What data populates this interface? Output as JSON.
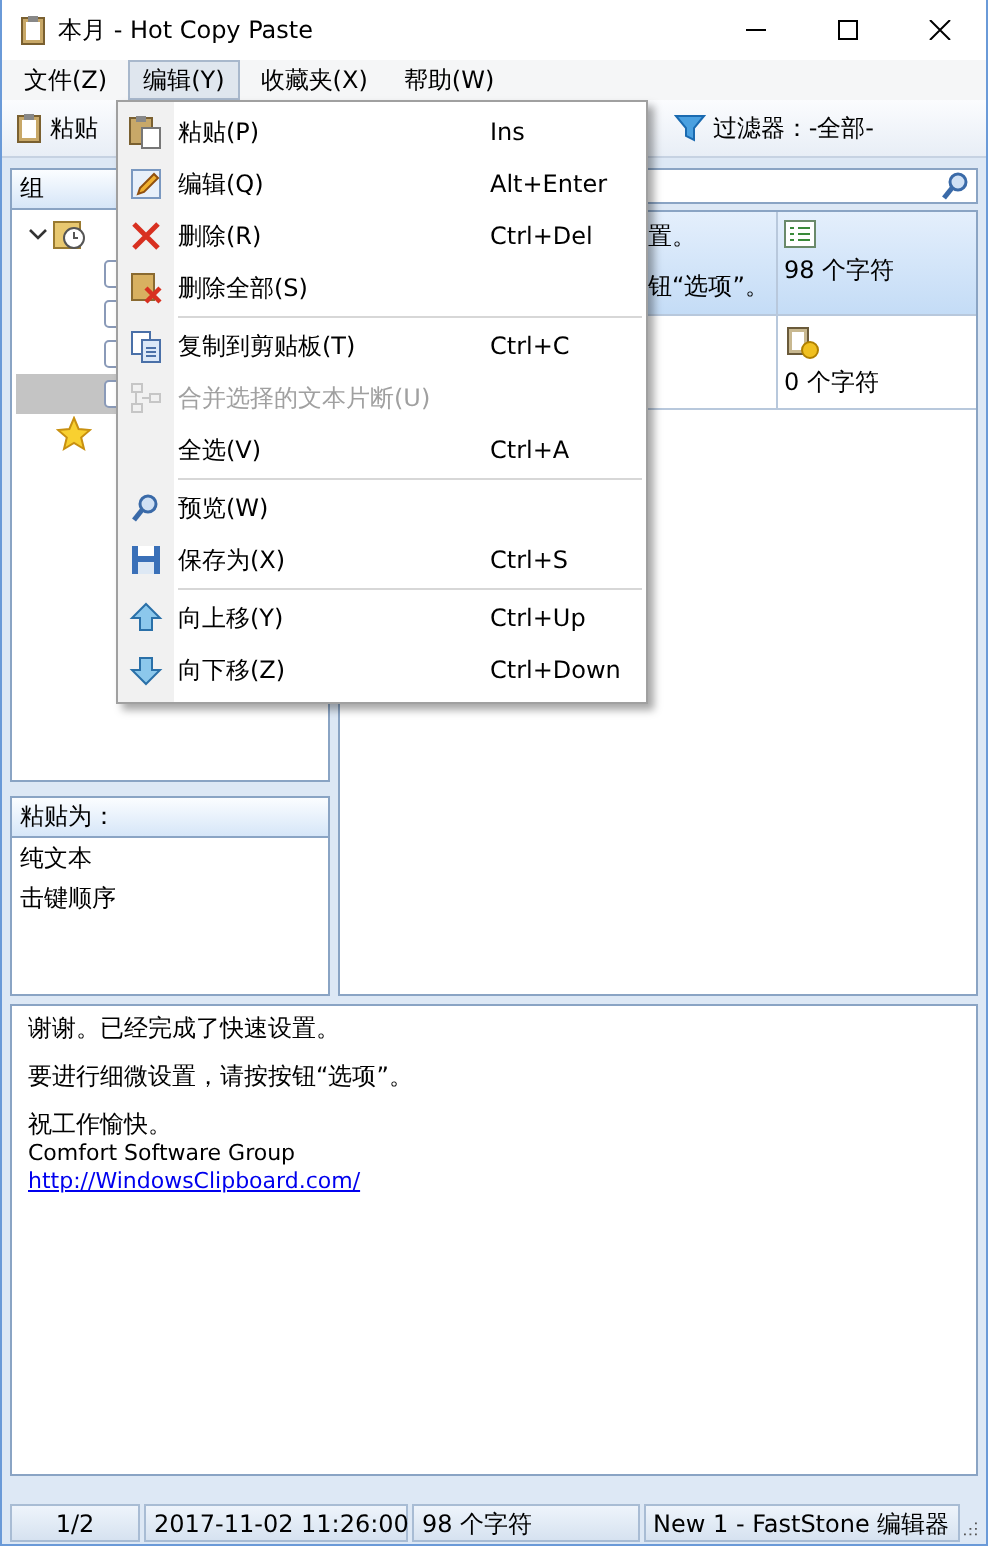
{
  "window": {
    "title": "本月 - Hot Copy Paste"
  },
  "menubar": [
    {
      "label": "文件(Z)",
      "selected": false
    },
    {
      "label": "编辑(Y)",
      "selected": true
    },
    {
      "label": "收藏夹(X)",
      "selected": false
    },
    {
      "label": "帮助(W)",
      "selected": false
    }
  ],
  "toolbar": {
    "paste_button": "粘贴",
    "filter": "过滤器：-全部-"
  },
  "groups_panel": {
    "header": "组",
    "tree": [
      {
        "kind": "history",
        "expanded": true,
        "children": [
          {
            "selected": false
          },
          {
            "selected": false
          },
          {
            "selected": false
          },
          {
            "selected": true
          }
        ]
      },
      {
        "kind": "favorites"
      }
    ]
  },
  "clips": {
    "rows": [
      {
        "selected": true,
        "kind": "text",
        "text": [
          "置。",
          "钮“选项”。"
        ],
        "size": "98 个字符"
      },
      {
        "selected": false,
        "kind": "clipboard",
        "size": "0 个字符"
      }
    ]
  },
  "paste_as": {
    "header": "粘贴为：",
    "items": [
      "纯文本",
      "击键顺序"
    ]
  },
  "preview": {
    "paragraphs": [
      "谢谢。已经完成了快速设置。",
      "要进行细微设置，请按按钮“选项”。",
      "祝工作愉快。"
    ],
    "signature": "Comfort Software Group",
    "link": "http://WindowsClipboard.com/"
  },
  "status_bar": [
    "1/2",
    "2017-11-02 11:26:00",
    "98 个字符",
    "New 1 - FastStone 编辑器"
  ],
  "menu": {
    "items": [
      {
        "kind": "item",
        "label": "粘贴(P)",
        "shortcut": "Ins",
        "disabled": false
      },
      {
        "kind": "item",
        "label": "编辑(Q)",
        "shortcut": "Alt+Enter",
        "disabled": false
      },
      {
        "kind": "item",
        "label": "删除(R)",
        "shortcut": "Ctrl+Del",
        "disabled": false
      },
      {
        "kind": "item",
        "label": "删除全部(S)",
        "disabled": false
      },
      {
        "kind": "separator"
      },
      {
        "kind": "item",
        "label": "复制到剪贴板(T)",
        "shortcut": "Ctrl+C",
        "disabled": false
      },
      {
        "kind": "item",
        "label": "合并选择的文本片断(U)",
        "disabled": true
      },
      {
        "kind": "item",
        "label": "全选(V)",
        "shortcut": "Ctrl+A",
        "disabled": false
      },
      {
        "kind": "separator"
      },
      {
        "kind": "item",
        "label": "预览(W)",
        "disabled": false
      },
      {
        "kind": "item",
        "label": "保存为(X)",
        "shortcut": "Ctrl+S",
        "disabled": false
      },
      {
        "kind": "separator"
      },
      {
        "kind": "item",
        "label": "向上移(Y)",
        "shortcut": "Ctrl+Up",
        "disabled": false
      },
      {
        "kind": "item",
        "label": "向下移(Z)",
        "shortcut": "Ctrl+Down",
        "disabled": false
      }
    ]
  }
}
